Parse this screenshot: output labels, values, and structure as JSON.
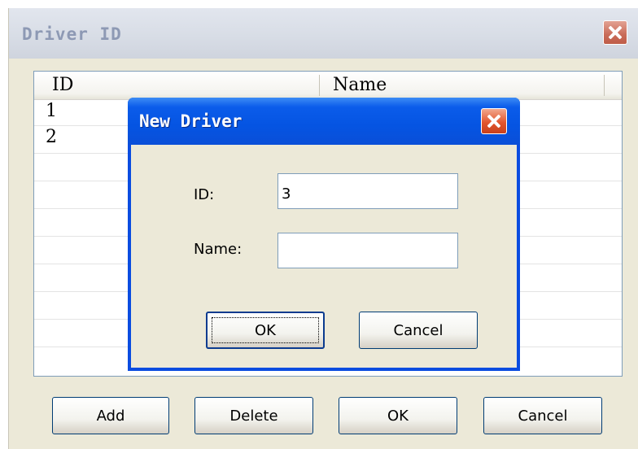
{
  "window": {
    "title": "Driver ID",
    "close_icon": "close-icon"
  },
  "list": {
    "columns": [
      "ID",
      "Name"
    ],
    "rows": [
      {
        "id": "1",
        "name": ""
      },
      {
        "id": "2",
        "name": ""
      }
    ]
  },
  "buttons": {
    "add": "Add",
    "delete": "Delete",
    "ok": "OK",
    "cancel": "Cancel"
  },
  "dialog": {
    "title": "New Driver",
    "close_icon": "close-icon",
    "id_label": "ID:",
    "id_value": "3",
    "name_label": "Name:",
    "name_value": "",
    "ok": "OK",
    "cancel": "Cancel"
  },
  "colors": {
    "title_active": "#0554e2",
    "close_red": "#e2562e",
    "face": "#ece9d8"
  }
}
